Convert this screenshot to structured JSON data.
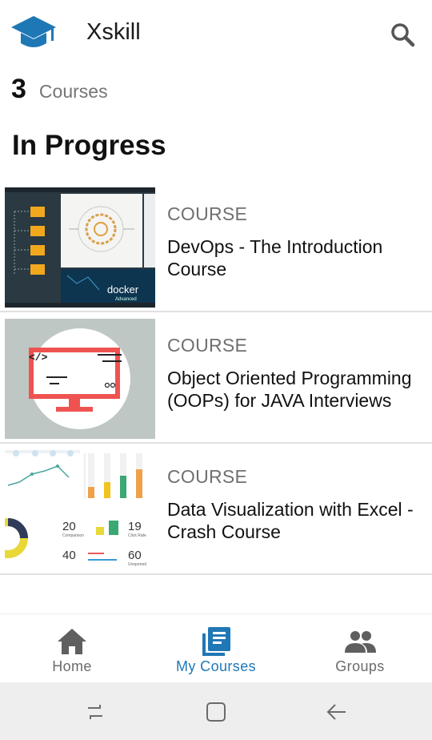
{
  "app": {
    "title": "Xskill",
    "brand_color": "#1f78b6"
  },
  "header": {
    "logo_icon": "graduation-cap-icon",
    "search_icon": "search-icon"
  },
  "summary": {
    "count": "3",
    "label": "Courses"
  },
  "section": {
    "title": "In Progress"
  },
  "courses": [
    {
      "type": "COURSE",
      "title": "DevOps - The Introduction Course",
      "thumb": "devops-docker-thumbnail",
      "thumb_text": "docker",
      "thumb_subtext": "Advanced"
    },
    {
      "type": "COURSE",
      "title": "Object Oriented Programming (OOPs) for JAVA Interviews",
      "thumb": "monitor-code-thumbnail",
      "thumb_text": "</>"
    },
    {
      "type": "COURSE",
      "title": "Data Visualization with Excel - Crash Course",
      "thumb": "dashboard-charts-thumbnail",
      "thumb_stats": [
        {
          "value": "20",
          "caption": "Comparison"
        },
        {
          "value": "19",
          "caption": "Click Rate"
        },
        {
          "value": "40",
          "caption": ""
        },
        {
          "value": "60",
          "caption": "Unopened"
        }
      ]
    }
  ],
  "bottom_nav": {
    "items": [
      {
        "label": "Home",
        "icon": "home-icon",
        "active": false
      },
      {
        "label": "My Courses",
        "icon": "book-icon",
        "active": true
      },
      {
        "label": "Groups",
        "icon": "groups-icon",
        "active": false
      }
    ],
    "active_color": "#1f78b6",
    "inactive_color": "#6b6b6b"
  },
  "system_bar": {
    "recent_icon": "recent-apps-icon",
    "home_icon": "system-home-icon",
    "back_icon": "back-arrow-icon"
  }
}
